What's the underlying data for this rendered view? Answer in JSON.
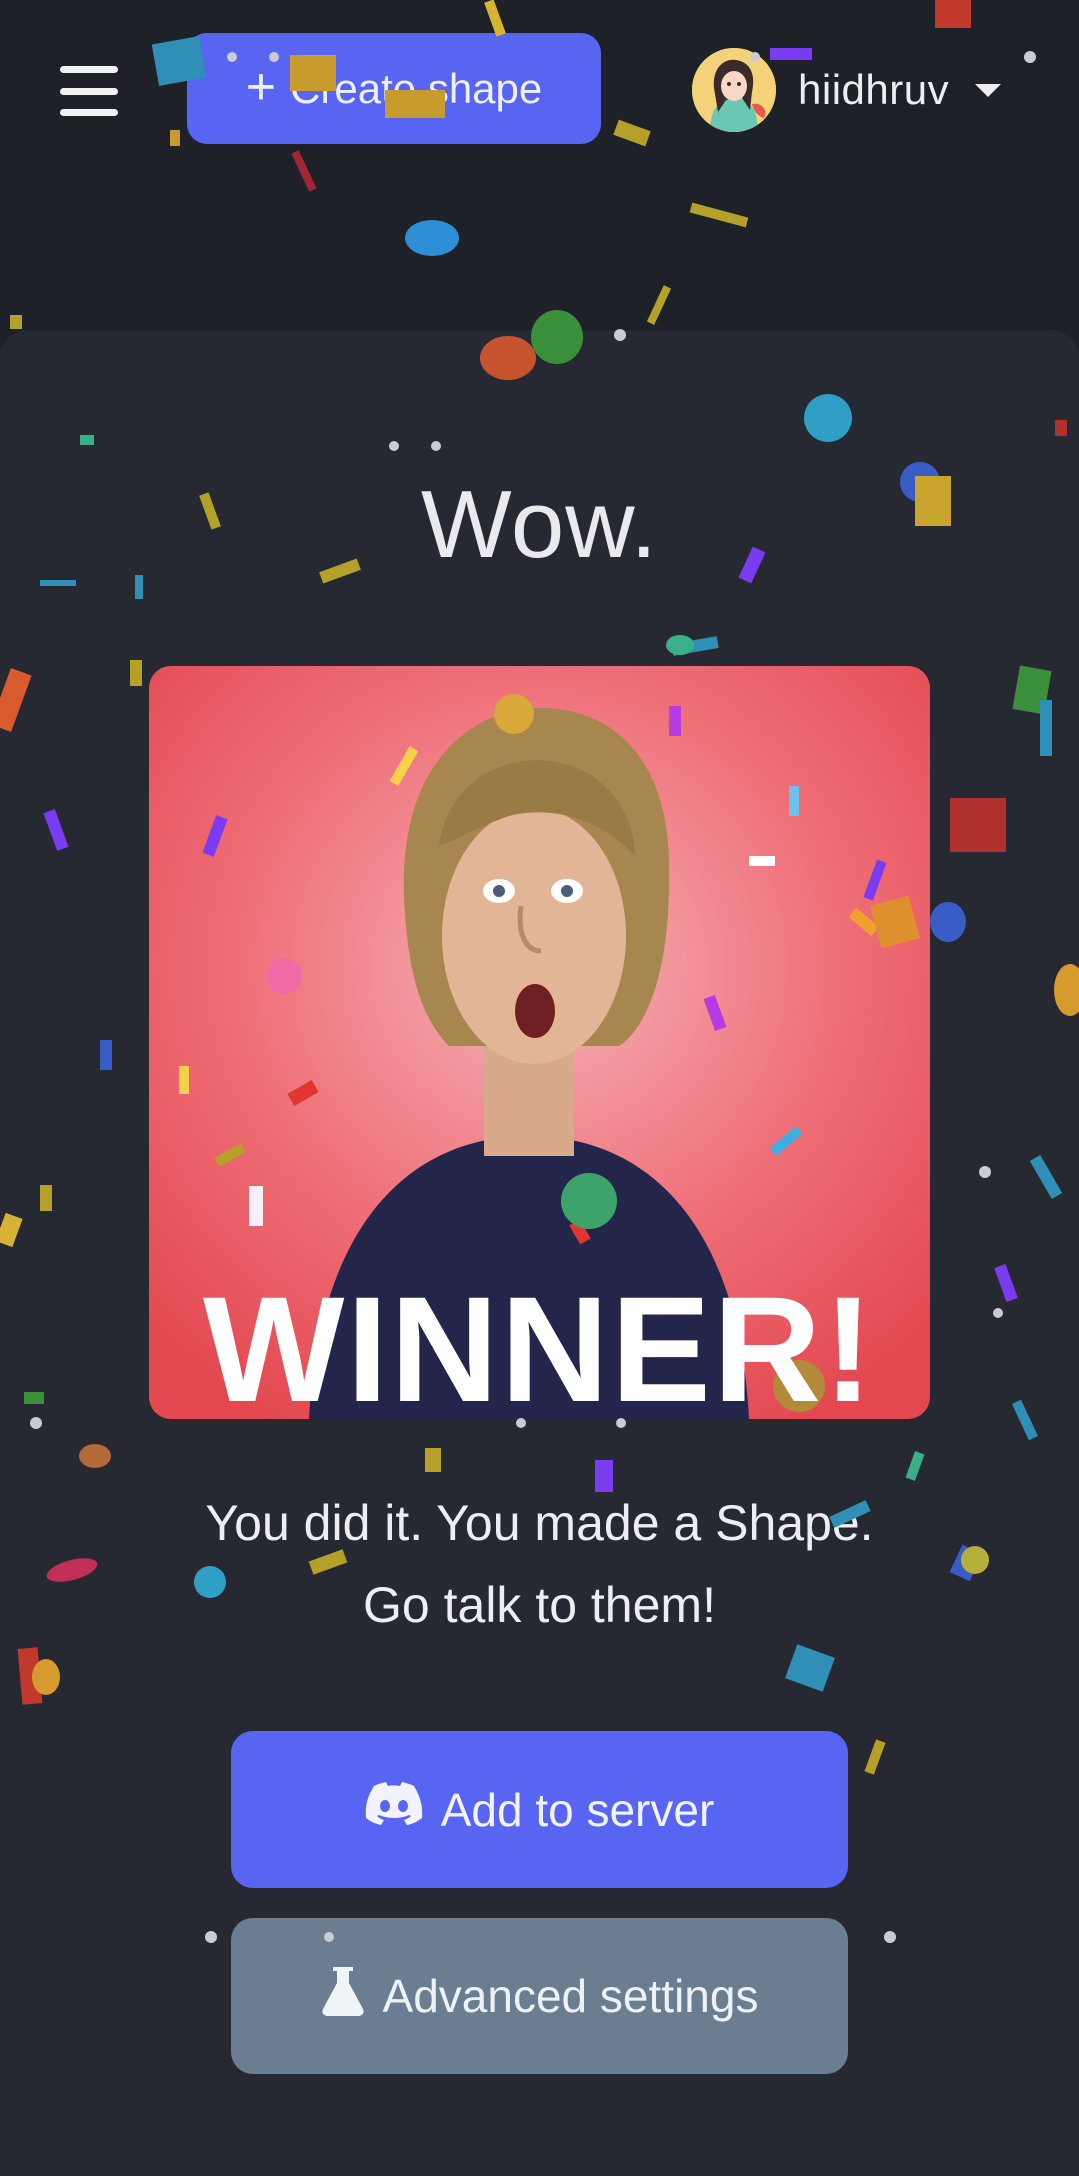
{
  "header": {
    "menu_icon": "hamburger-menu-icon",
    "create_button": {
      "icon": "plus-icon",
      "label": "Create shape"
    },
    "user": {
      "avatar": "anime-avatar",
      "username": "hiidhruv",
      "dropdown_icon": "caret-down-icon"
    }
  },
  "main": {
    "title": "Wow.",
    "gif": {
      "caption": "WINNER!"
    },
    "message_line1": "You did it. You made a Shape.",
    "message_line2": "Go talk to them!",
    "add_button": {
      "icon": "discord-icon",
      "label": "Add to server"
    },
    "advanced_button": {
      "icon": "flask-icon",
      "label": "Advanced settings"
    }
  },
  "colors": {
    "background": "#1f2129",
    "card": "#262931",
    "accent": "#5865f2",
    "secondary": "#6b7d90"
  }
}
